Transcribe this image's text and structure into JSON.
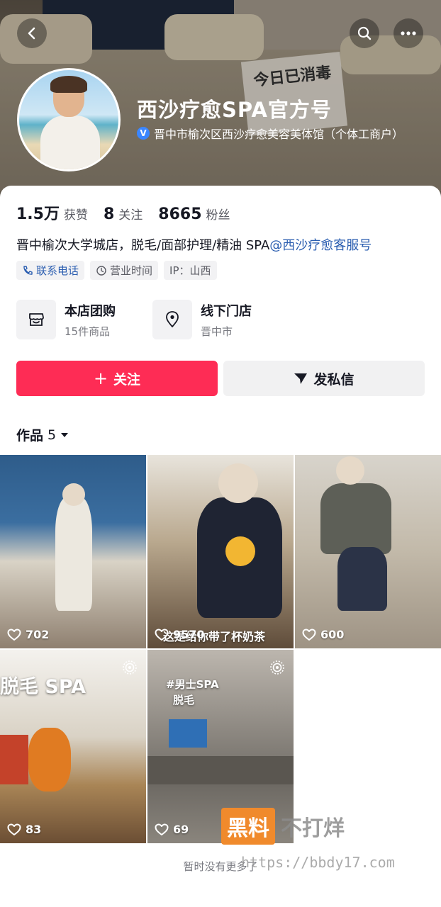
{
  "profile": {
    "name": "西沙疗愈SPA官方号",
    "verify_badge": "V",
    "verify_text": "晋中市榆次区西沙疗愈美容美体馆（个体工商户）",
    "cover_sign": "今日已消毒"
  },
  "stats": [
    {
      "value": "1.5万",
      "label": "获赞"
    },
    {
      "value": "8",
      "label": "关注"
    },
    {
      "value": "8665",
      "label": "粉丝"
    }
  ],
  "bio": {
    "text": "晋中榆次大学城店，脱毛/面部护理/精油 SPA",
    "mention": "@西沙疗愈客服号"
  },
  "tags": [
    {
      "label": "联系电话",
      "icon": "phone-icon"
    },
    {
      "label": "营业时间",
      "icon": "clock-icon"
    },
    {
      "label": "IP：山西",
      "icon": ""
    }
  ],
  "services": [
    {
      "title": "本店团购",
      "sub": "15件商品",
      "icon": "store-icon"
    },
    {
      "title": "线下门店",
      "sub": "晋中市",
      "icon": "location-pin-icon"
    }
  ],
  "actions": {
    "follow": "关注",
    "follow_icon": "+",
    "message": "发私信"
  },
  "works": {
    "label": "作品",
    "count": "5"
  },
  "videos": [
    {
      "likes": "702",
      "overlay": ""
    },
    {
      "likes": "9570",
      "overlay": "这是给你带了杯奶茶"
    },
    {
      "likes": "600",
      "overlay": ""
    },
    {
      "likes": "83",
      "overlay": "脱毛 SPA"
    },
    {
      "likes": "69",
      "overlay_line1": "#男士SPA",
      "overlay_line2": "脱毛"
    }
  ],
  "footer": {
    "empty_note": "暂时没有更多了"
  },
  "watermark": {
    "box": "黑料",
    "text": "不打烊",
    "url": "https://bbdy17.com"
  },
  "colors": {
    "accent": "#fe2c55",
    "link": "#2a5db0",
    "verify": "#3a86ff"
  }
}
